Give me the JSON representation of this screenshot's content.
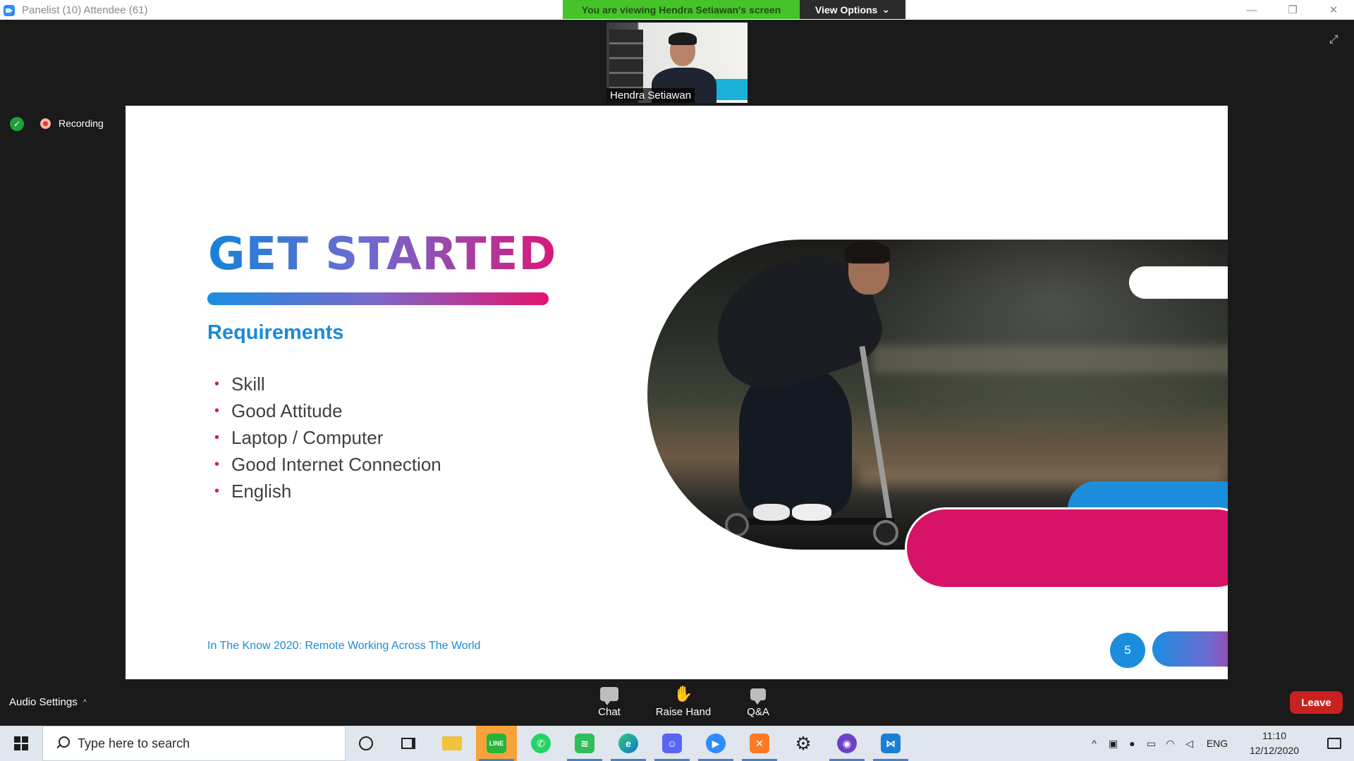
{
  "window": {
    "title": "Panelist (10) Attendee (61)",
    "controls": [
      "—",
      "❐",
      "✕"
    ]
  },
  "share_banner": {
    "text": "You are viewing Hendra Setiawan's screen",
    "view_options_label": "View Options",
    "view_options_caret": "⌄"
  },
  "video": {
    "participant_name": "Hendra Setiawan"
  },
  "recording": {
    "label": "Recording"
  },
  "slide": {
    "title": "GET STARTED",
    "section_heading": "Requirements",
    "requirements": [
      "Skill",
      "Good Attitude",
      "Laptop / Computer",
      "Good Internet Connection",
      "English"
    ],
    "bullet": "•",
    "footer": "In The Know 2020: Remote Working Across The World",
    "page_number": "5",
    "colors": {
      "blue": "#1b8ddc",
      "pink": "#d61366",
      "purple": "#7d67c8"
    }
  },
  "meeting_bar": {
    "audio_settings_label": "Audio Settings",
    "audio_settings_caret": "^",
    "chat_label": "Chat",
    "raise_hand_label": "Raise Hand",
    "qa_label": "Q&A",
    "leave_label": "Leave"
  },
  "taskbar": {
    "search_placeholder": "Type here to search",
    "apps": [
      {
        "name": "cortana-icon"
      },
      {
        "name": "task-view-icon"
      },
      {
        "name": "file-explorer-icon"
      },
      {
        "name": "line-icon",
        "text": "LINE"
      },
      {
        "name": "whatsapp-icon"
      },
      {
        "name": "spotify-icon"
      },
      {
        "name": "edge-icon"
      },
      {
        "name": "discord-icon"
      },
      {
        "name": "zoom-icon"
      },
      {
        "name": "xampp-icon"
      },
      {
        "name": "settings-icon"
      },
      {
        "name": "github-icon"
      },
      {
        "name": "vscode-icon"
      }
    ],
    "tray_language": "ENG",
    "time": "11:10",
    "date": "12/12/2020"
  }
}
